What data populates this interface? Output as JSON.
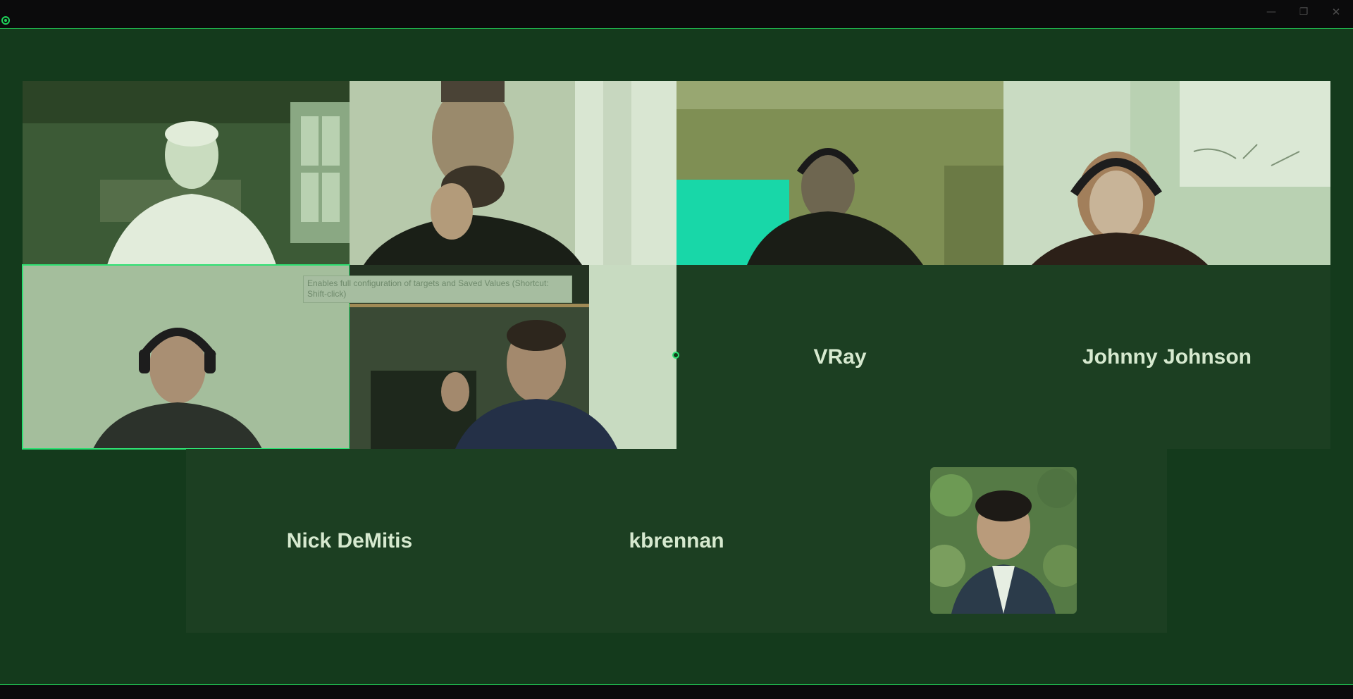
{
  "window": {
    "controls": {
      "minimize": "—",
      "maximize": "❐",
      "close": "✕"
    }
  },
  "tooltip": {
    "text": "Enables full configuration of targets and Saved Values (Shortcut: Shift-click)"
  },
  "participants": [
    {
      "type": "video",
      "description_icon": "person-video"
    },
    {
      "type": "video",
      "description_icon": "person-video"
    },
    {
      "type": "video",
      "description_icon": "person-video"
    },
    {
      "type": "video",
      "description_icon": "person-video"
    },
    {
      "type": "video",
      "description_icon": "person-video",
      "active": true
    },
    {
      "type": "video",
      "description_icon": "person-video"
    },
    {
      "type": "name",
      "name": "VRay"
    },
    {
      "type": "name",
      "name": "Johnny Johnson"
    },
    {
      "type": "name",
      "name": "Nick DeMitis"
    },
    {
      "type": "name",
      "name": "kbrennan"
    },
    {
      "type": "photo",
      "description_icon": "profile-photo"
    }
  ],
  "colors": {
    "stage_bg": "#143a1c",
    "tile_bg": "#1c3f22",
    "accent": "#2ee072",
    "name_text": "#d6e9cf"
  }
}
